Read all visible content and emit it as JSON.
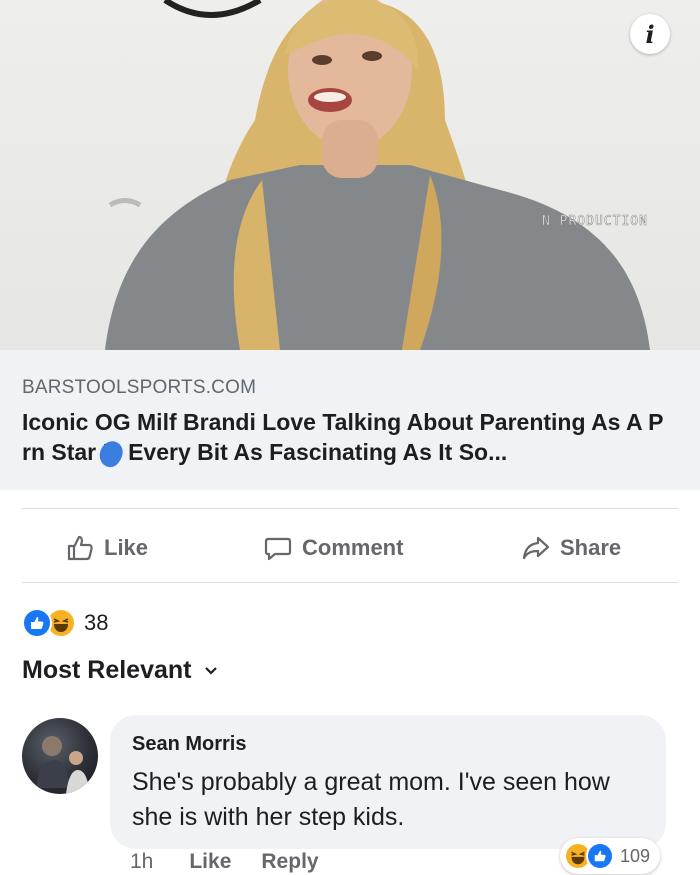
{
  "hero": {
    "info_glyph": "i",
    "watermark": "N PRODUCTION"
  },
  "link_preview": {
    "domain": "BARSTOOLSPORTS.COM",
    "headline": "Iconic OG Milf Brandi Love Talking About Parenting As A P rn Star Is Every Bit As Fascinating As It So..."
  },
  "actions": {
    "like_label": "Like",
    "comment_label": "Comment",
    "share_label": "Share",
    "like_icon": "thumbs-up-icon",
    "comment_icon": "speech-bubble-icon",
    "share_icon": "share-arrow-icon"
  },
  "reactions": {
    "count": "38",
    "types": [
      "like",
      "haha"
    ],
    "like_color": "#1877f2",
    "haha_color": "#f7b125"
  },
  "comments_sort": {
    "label": "Most Relevant",
    "icon": "chevron-down-icon"
  },
  "comment": {
    "author": "Sean Morris",
    "text": "She's probably a great mom. I've seen how she is with her step kids.",
    "time": "1h",
    "like_label": "Like",
    "reply_label": "Reply",
    "reaction_count": "109"
  },
  "colors": {
    "accent": "#1877f2",
    "muted_text": "#65676b",
    "bubble_bg": "#f0f2f5"
  }
}
